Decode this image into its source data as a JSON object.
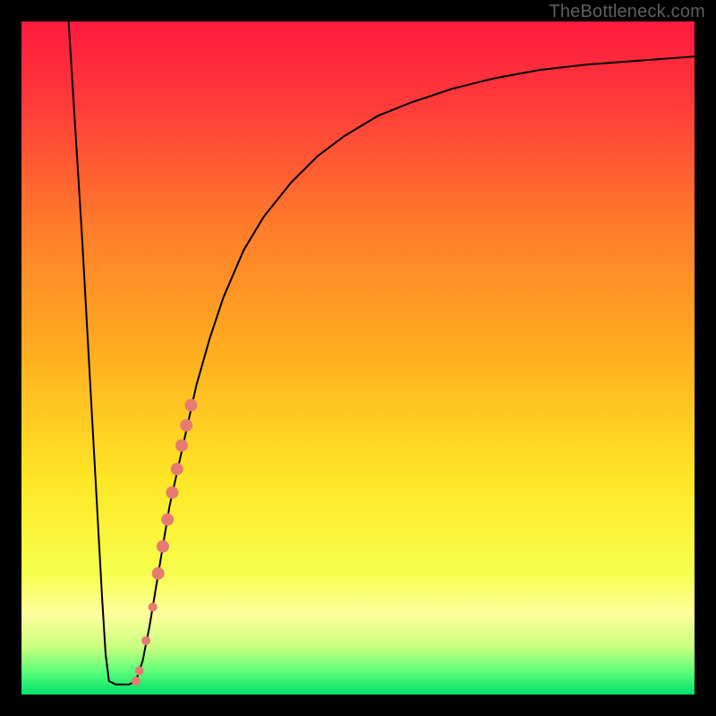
{
  "attribution": "TheBottleneck.com",
  "colors": {
    "frame": "#000000",
    "gradient_stops": [
      {
        "offset": 0.0,
        "color": "#ff1a3f"
      },
      {
        "offset": 0.12,
        "color": "#ff3a3a"
      },
      {
        "offset": 0.3,
        "color": "#ff7a2b"
      },
      {
        "offset": 0.5,
        "color": "#ffb01f"
      },
      {
        "offset": 0.68,
        "color": "#ffe626"
      },
      {
        "offset": 0.82,
        "color": "#f6ff4d"
      },
      {
        "offset": 0.88,
        "color": "#ffff9e"
      },
      {
        "offset": 0.93,
        "color": "#c8ff7e"
      },
      {
        "offset": 0.965,
        "color": "#5eff7a"
      },
      {
        "offset": 1.0,
        "color": "#00e06a"
      }
    ],
    "curve": "#000000",
    "marker": "#e77b72"
  },
  "chart_data": {
    "type": "line",
    "title": "",
    "xlabel": "",
    "ylabel": "",
    "xlim": [
      0,
      100
    ],
    "ylim": [
      0,
      100
    ],
    "series": [
      {
        "name": "curve-left",
        "x": [
          7,
          7.5,
          8,
          8.5,
          9,
          9.5,
          10,
          10.5,
          11,
          11.5,
          12,
          12.5,
          13
        ],
        "y": [
          100,
          92,
          84,
          76,
          68,
          59,
          50,
          41,
          32,
          23,
          14,
          6,
          2
        ]
      },
      {
        "name": "curve-floor",
        "x": [
          13,
          14,
          15,
          16,
          17
        ],
        "y": [
          2,
          1.5,
          1.5,
          1.5,
          2
        ]
      },
      {
        "name": "curve-right",
        "x": [
          17,
          18,
          19,
          20,
          21,
          22,
          24,
          26,
          28,
          30,
          33,
          36,
          40,
          44,
          48,
          53,
          58,
          64,
          70,
          77,
          84,
          92,
          100
        ],
        "y": [
          2,
          5,
          10,
          16,
          22,
          28,
          37,
          46,
          53,
          59,
          66,
          71,
          76,
          80,
          83,
          86,
          88,
          90,
          91.5,
          92.8,
          93.6,
          94.2,
          94.8
        ]
      }
    ],
    "markers": {
      "name": "highlight-points",
      "color": "#e77b72",
      "points": [
        {
          "x": 17.0,
          "y": 2.0,
          "r": 5
        },
        {
          "x": 17.5,
          "y": 3.5,
          "r": 5
        },
        {
          "x": 18.5,
          "y": 8.0,
          "r": 5
        },
        {
          "x": 19.5,
          "y": 13.0,
          "r": 5
        },
        {
          "x": 20.3,
          "y": 18.0,
          "r": 7
        },
        {
          "x": 21.0,
          "y": 22.0,
          "r": 7
        },
        {
          "x": 21.7,
          "y": 26.0,
          "r": 7
        },
        {
          "x": 22.4,
          "y": 30.0,
          "r": 7
        },
        {
          "x": 23.1,
          "y": 33.5,
          "r": 7
        },
        {
          "x": 23.8,
          "y": 37.0,
          "r": 7
        },
        {
          "x": 24.5,
          "y": 40.0,
          "r": 7
        },
        {
          "x": 25.2,
          "y": 43.0,
          "r": 7
        }
      ]
    }
  }
}
